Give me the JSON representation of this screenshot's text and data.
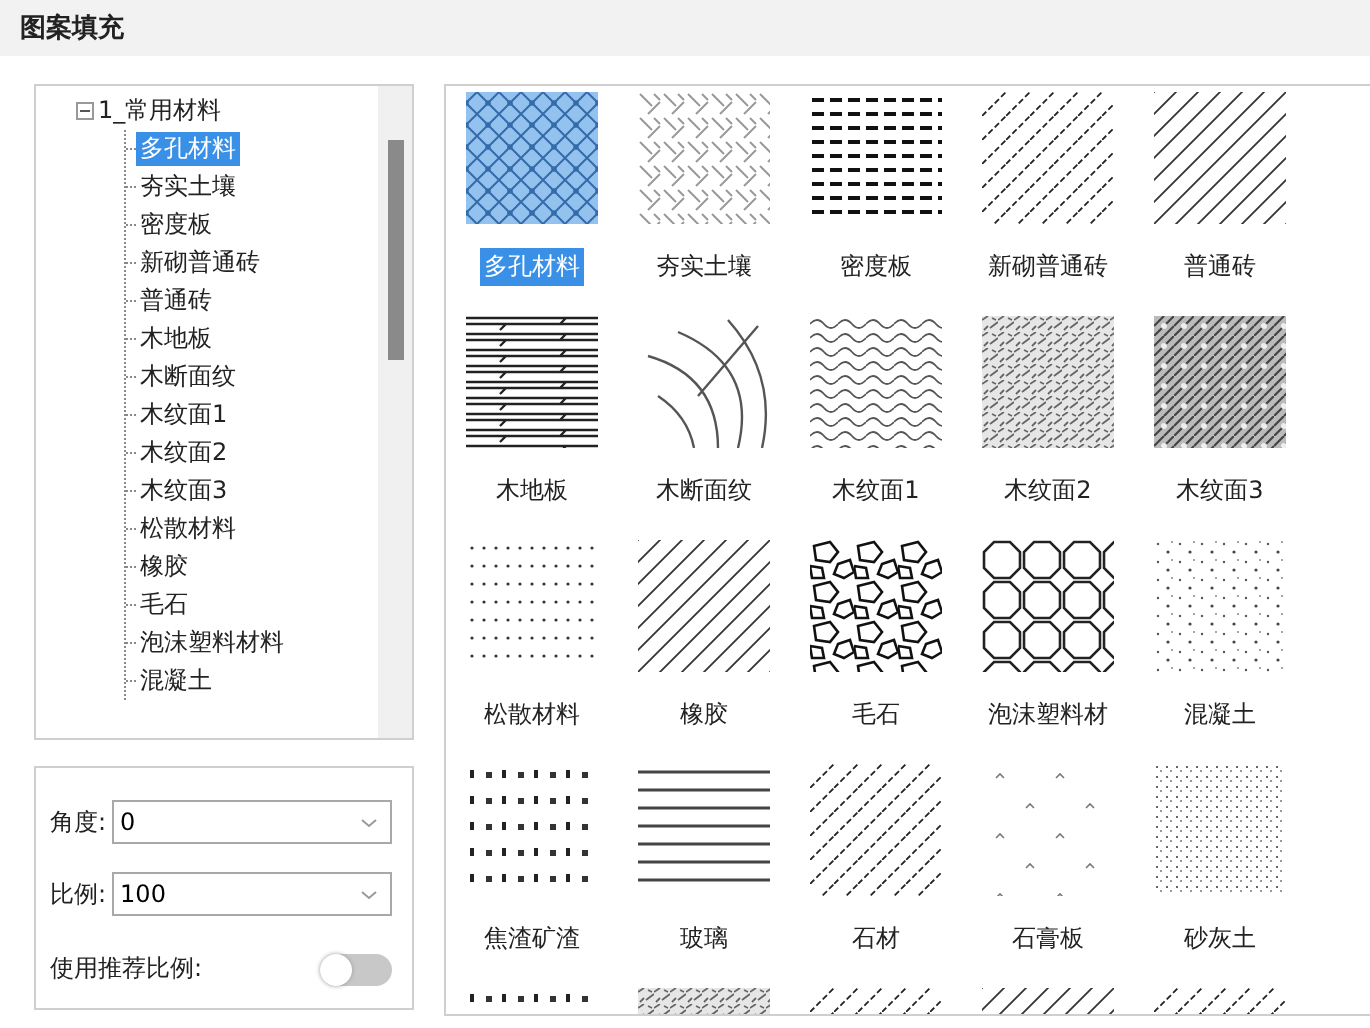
{
  "window": {
    "title": "图案填充"
  },
  "tree": {
    "label": "1_常用材料",
    "expanded": true,
    "children": [
      {
        "label": "多孔材料",
        "selected": true
      },
      {
        "label": "夯实土壤",
        "selected": false
      },
      {
        "label": "密度板",
        "selected": false
      },
      {
        "label": "新砌普通砖",
        "selected": false
      },
      {
        "label": "普通砖",
        "selected": false
      },
      {
        "label": "木地板",
        "selected": false
      },
      {
        "label": "木断面纹",
        "selected": false
      },
      {
        "label": "木纹面1",
        "selected": false
      },
      {
        "label": "木纹面2",
        "selected": false
      },
      {
        "label": "木纹面3",
        "selected": false
      },
      {
        "label": "松散材料",
        "selected": false
      },
      {
        "label": "橡胶",
        "selected": false
      },
      {
        "label": "毛石",
        "selected": false
      },
      {
        "label": "泡沫塑料材料",
        "selected": false
      },
      {
        "label": "混凝土",
        "selected": false
      }
    ]
  },
  "settings": {
    "angle": {
      "label": "角度:",
      "value": "0"
    },
    "scale": {
      "label": "比例:",
      "value": "100"
    },
    "recommended_scale": {
      "label": "使用推荐比例:",
      "on": false
    }
  },
  "swatches": [
    {
      "label": "多孔材料",
      "kind": "lattice",
      "selected": true
    },
    {
      "label": "夯实土壤",
      "kind": "herringbone",
      "selected": false
    },
    {
      "label": "密度板",
      "kind": "dashes",
      "selected": false
    },
    {
      "label": "新砌普通砖",
      "kind": "hatch",
      "selected": false
    },
    {
      "label": "普通砖",
      "kind": "diagonal",
      "selected": false
    },
    {
      "label": "木地板",
      "kind": "planks",
      "selected": false
    },
    {
      "label": "木断面纹",
      "kind": "arcs",
      "selected": false
    },
    {
      "label": "木纹面1",
      "kind": "waves",
      "selected": false
    },
    {
      "label": "木纹面2",
      "kind": "noise",
      "selected": false
    },
    {
      "label": "木纹面3",
      "kind": "dense",
      "selected": false
    },
    {
      "label": "松散材料",
      "kind": "dots",
      "selected": false
    },
    {
      "label": "橡胶",
      "kind": "diagonal",
      "selected": false
    },
    {
      "label": "毛石",
      "kind": "stones",
      "selected": false
    },
    {
      "label": "泡沫塑料材",
      "kind": "octagons",
      "selected": false
    },
    {
      "label": "混凝土",
      "kind": "speckle",
      "selected": false
    },
    {
      "label": "焦渣矿渣",
      "kind": "slag",
      "selected": false
    },
    {
      "label": "玻璃",
      "kind": "glass",
      "selected": false
    },
    {
      "label": "石材",
      "kind": "hatch",
      "selected": false
    },
    {
      "label": "石膏板",
      "kind": "sparse",
      "selected": false
    },
    {
      "label": "砂灰土",
      "kind": "sand",
      "selected": false
    }
  ],
  "partial_swatches": [
    {
      "kind": "slag"
    },
    {
      "kind": "noise"
    },
    {
      "kind": "hatch"
    },
    {
      "kind": "diagonal"
    },
    {
      "kind": "hatch"
    }
  ]
}
